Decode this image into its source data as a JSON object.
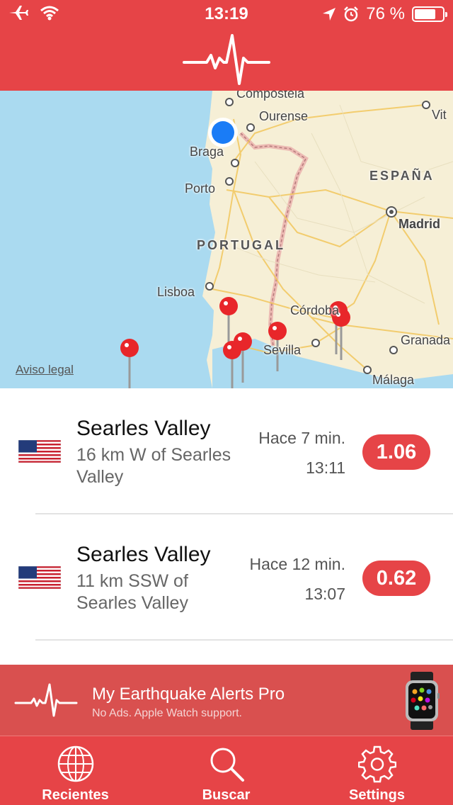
{
  "status_bar": {
    "time": "13:19",
    "battery_text": "76 %",
    "battery_level": 0.76,
    "icons": [
      "airplane-icon",
      "wifi-icon",
      "location-arrow-icon",
      "alarm-icon",
      "battery-icon"
    ]
  },
  "header": {
    "logo_icon": "heartbeat-icon"
  },
  "map": {
    "labels": {
      "compostela": "Compostela",
      "ourense": "Ourense",
      "vit": "Vit",
      "braga": "Braga",
      "porto": "Porto",
      "espana": "ESPAÑA",
      "madrid": "Madrid",
      "portugal": "PORTUGAL",
      "lisboa": "Lisboa",
      "cordoba": "Córdoba",
      "sevilla": "Sevilla",
      "granada": "Granada",
      "malaga": "Málaga"
    },
    "legal_link": "Aviso legal",
    "colors": {
      "sea": "#aadaf0",
      "land": "#f6efd6",
      "pin": "#e8262a",
      "user_location": "#1a7cf6"
    }
  },
  "quakes": [
    {
      "flag": "us-flag-icon",
      "title": "Searles Valley",
      "subtitle": "16 km W of Searles Valley",
      "ago": "Hace 7 min.",
      "time": "13:11",
      "magnitude": "1.06"
    },
    {
      "flag": "us-flag-icon",
      "title": "Searles Valley",
      "subtitle": "11 km SSW of Searles Valley",
      "ago": "Hace 12 min.",
      "time": "13:07",
      "magnitude": "0.62"
    }
  ],
  "promo": {
    "title": "My Earthquake Alerts Pro",
    "subtitle": "No Ads. Apple Watch support.",
    "image": "apple-watch-icon"
  },
  "tabbar": {
    "tabs": [
      {
        "label": "Recientes",
        "icon": "globe-icon"
      },
      {
        "label": "Buscar",
        "icon": "search-icon"
      },
      {
        "label": "Settings",
        "icon": "gear-icon"
      }
    ]
  },
  "colors": {
    "accent": "#e64447",
    "promo_bg": "#d9504f"
  }
}
